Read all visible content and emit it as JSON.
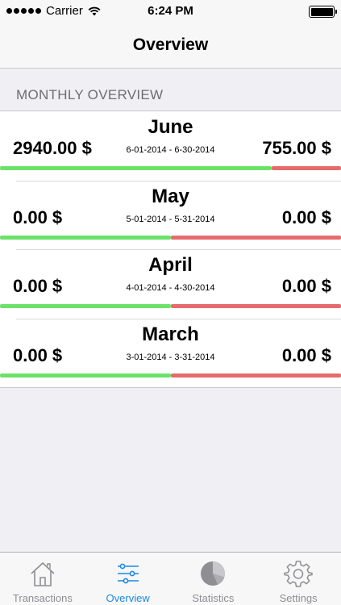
{
  "status_bar": {
    "carrier": "Carrier",
    "time": "6:24 PM"
  },
  "nav": {
    "title": "Overview"
  },
  "section": {
    "header": "MONTHLY OVERVIEW"
  },
  "months": [
    {
      "name": "June",
      "income": "2940.00 $",
      "range": "6-01-2014 - 6-30-2014",
      "expense": "755.00 $",
      "income_share": 0.796
    },
    {
      "name": "May",
      "income": "0.00 $",
      "range": "5-01-2014 - 5-31-2014",
      "expense": "0.00 $",
      "income_share": 0.5
    },
    {
      "name": "April",
      "income": "0.00 $",
      "range": "4-01-2014 - 4-30-2014",
      "expense": "0.00 $",
      "income_share": 0.5
    },
    {
      "name": "March",
      "income": "0.00 $",
      "range": "3-01-2014 - 3-31-2014",
      "expense": "0.00 $",
      "income_share": 0.5
    }
  ],
  "colors": {
    "income_bar": "#6ce26a",
    "expense_bar": "#e66b6b",
    "tab_active": "#1a8ae5",
    "tab_inactive": "#8e8e93"
  },
  "tabs": [
    {
      "label": "Transactions",
      "icon": "house-icon",
      "active": false
    },
    {
      "label": "Overview",
      "icon": "sliders-icon",
      "active": true
    },
    {
      "label": "Statistics",
      "icon": "pie-chart-icon",
      "active": false
    },
    {
      "label": "Settings",
      "icon": "gear-icon",
      "active": false
    }
  ]
}
